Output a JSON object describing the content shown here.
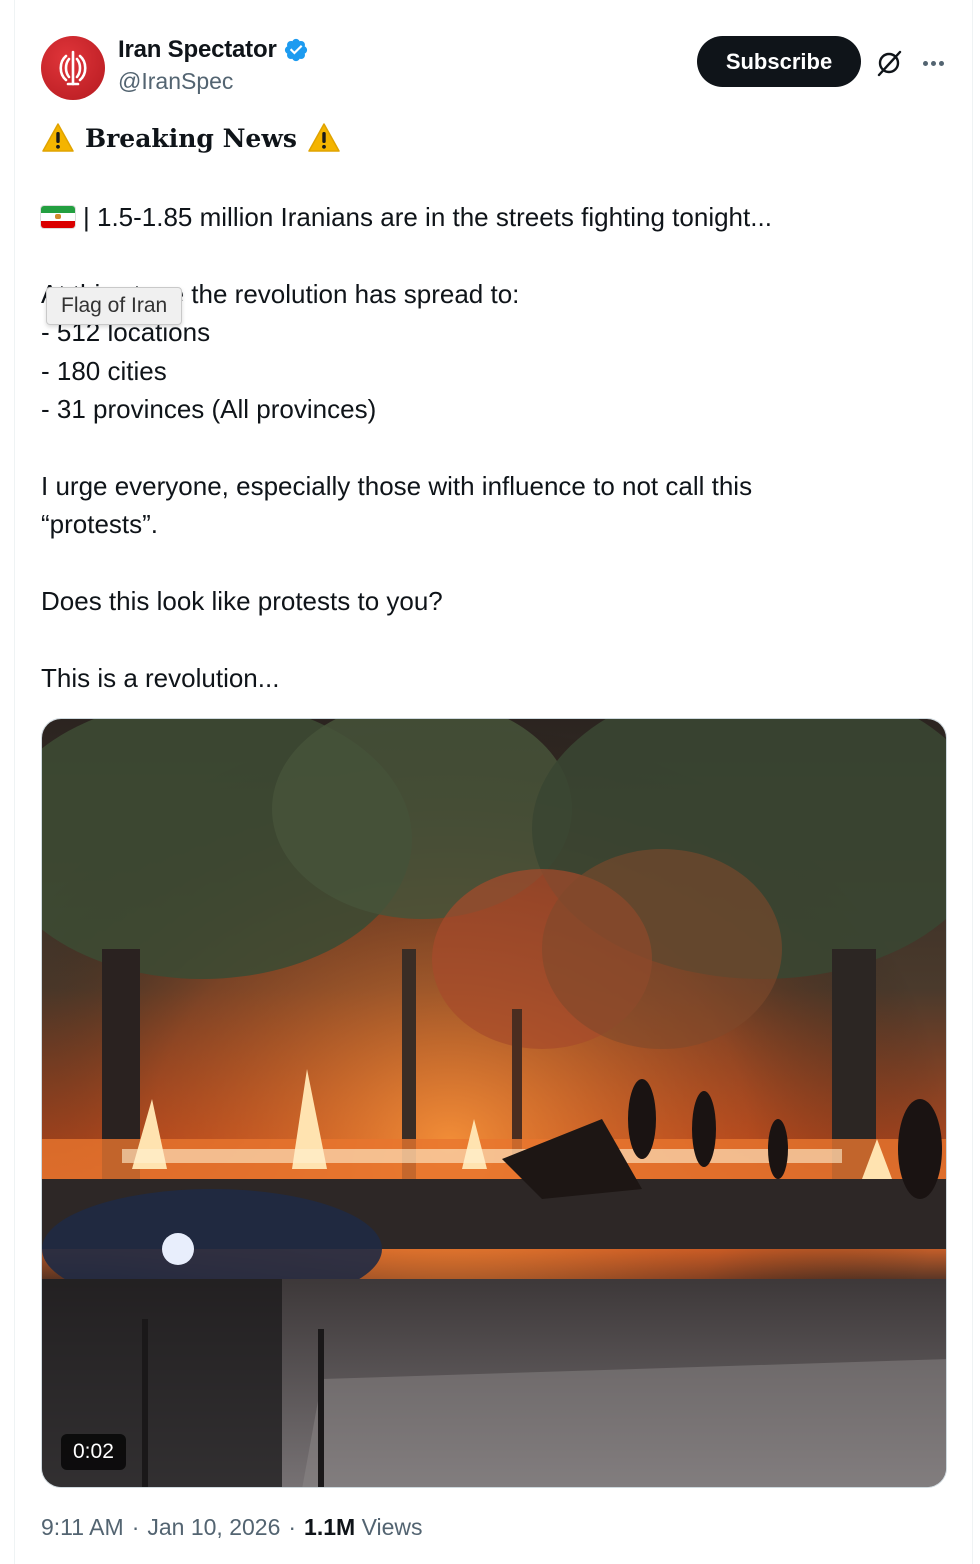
{
  "post": {
    "author": {
      "display_name": "Iran Spectator",
      "handle": "@IranSpec",
      "verified": true,
      "avatar_icon": "iran-emblem-icon"
    },
    "subscribe_label": "Subscribe",
    "breaking_label": "Breaking News",
    "line_main": "| 1.5-1.85 million Iranians are in the streets fighting tonight...",
    "line_spread": "At this stage the revolution has spread to:",
    "tooltip": "Flag of Iran",
    "list": [
      "- 512 locations",
      "- 180 cities",
      "- 31 provinces (All provinces)"
    ],
    "urge_line1": "I urge everyone, especially those with influence to not call this",
    "urge_line2": "“protests”.",
    "question": "Does this look like protests to you?",
    "closing": "This is a revolution...",
    "video_duration": "0:02",
    "time": "9:11 AM",
    "date": "Jan 10, 2026",
    "views_count": "1.1M",
    "views_label": "Views"
  },
  "colors": {
    "text": "#0f1419",
    "secondary": "#536471",
    "verified": "#1d9bf0",
    "button_bg": "#0f1419",
    "avatar_red": "#c8232a"
  }
}
